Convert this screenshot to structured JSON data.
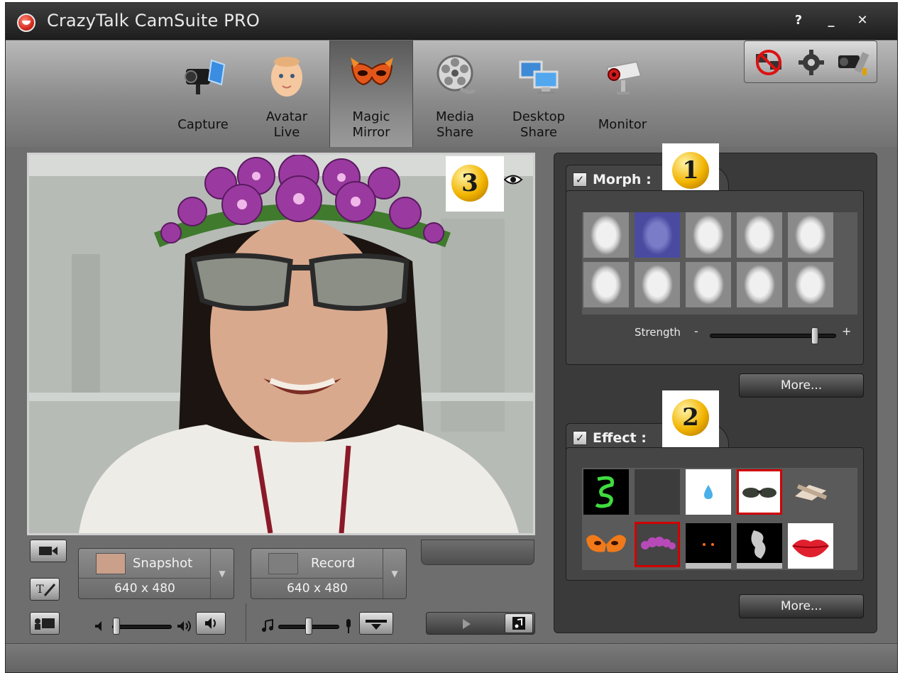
{
  "window": {
    "title": "CrazyTalk CamSuite PRO",
    "help": "?",
    "minimize": "_",
    "close": "✕"
  },
  "tabs": [
    {
      "id": "capture",
      "label": "Capture",
      "icon": "camera-icon"
    },
    {
      "id": "avatar-live",
      "label": "Avatar\nLive",
      "icon": "baby-avatar-icon"
    },
    {
      "id": "magic-mirror",
      "label": "Magic\nMirror",
      "icon": "mask-icon",
      "active": true
    },
    {
      "id": "media-share",
      "label": "Media\nShare",
      "icon": "film-reel-icon"
    },
    {
      "id": "desktop-share",
      "label": "Desktop\nShare",
      "icon": "monitors-icon"
    },
    {
      "id": "monitor",
      "label": "Monitor",
      "icon": "security-camera-icon"
    }
  ],
  "topright": [
    "network-off-icon",
    "gear-icon",
    "camera-settings-icon"
  ],
  "badges": {
    "one": "1",
    "two": "2",
    "three": "3"
  },
  "morph": {
    "label": "Morph :",
    "checked": true,
    "strength_label": "Strength",
    "minus": "-",
    "plus": "+",
    "strength": 0.85,
    "more": "More..."
  },
  "effect": {
    "label": "Effect :",
    "checked": true,
    "more": "More..."
  },
  "snapshot": {
    "label": "Snapshot",
    "resolution": "640 x 480"
  },
  "record": {
    "label": "Record",
    "resolution": "640 x 480"
  },
  "volume": {
    "speaker": 0.02,
    "mic": 0.5
  },
  "colors": {
    "accent": "#f2b400",
    "selected": "#d00000"
  }
}
